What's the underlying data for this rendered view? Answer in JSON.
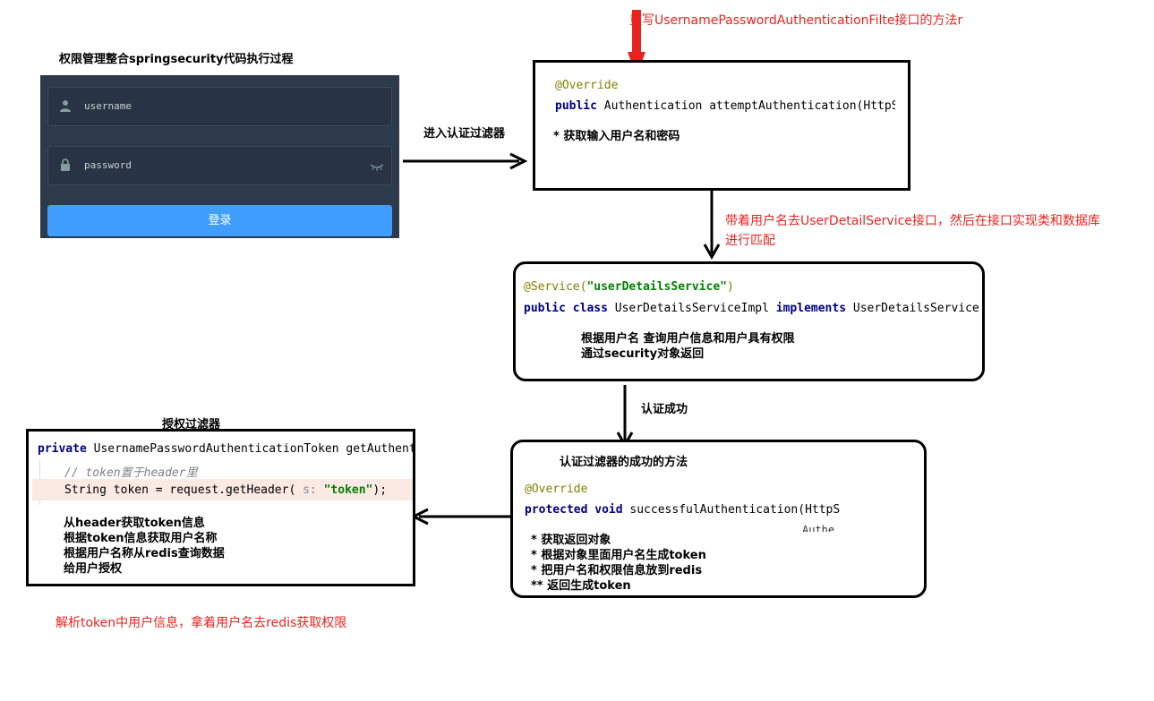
{
  "title": "权限管理整合springsecurity代码执行过程",
  "login": {
    "username_placeholder": "username",
    "password_placeholder": "password",
    "login_button": "登录"
  },
  "arrows": {
    "enter_filter": "进入认证过滤器",
    "auth_success": "认证成功"
  },
  "annotations": {
    "override_note": "重写UsernamePasswordAuthenticationFilte接口的方法r",
    "user_detail_note_line1": "带着用户名去UserDetailService接口，然后在接口实现类和数据库",
    "user_detail_note_line2": "进行匹配",
    "parse_token_note": "解析token中用户信息，拿着用户名去redis获取权限"
  },
  "box_attempt": {
    "annotation": "@Override",
    "kw_public": "public",
    "signature": " Authentication attemptAuthentication(HttpS",
    "note": "* 获取输入用户名和密码"
  },
  "box_service": {
    "annotation": "@Service(",
    "annotation_value": "\"userDetailsService\"",
    "annotation_close": ")",
    "kw_public_class": "public class",
    "class_name": " UserDetailsServiceImpl ",
    "kw_implements": "implements",
    "interface_name": " UserDetailsService",
    "note_line1": "根据用户名 查询用户信息和用户具有权限",
    "note_line2": "通过security对象返回"
  },
  "box_success": {
    "heading": "认证过滤器的成功的方法",
    "annotation": "@Override",
    "kw_protected_void": "protected void",
    "signature": " successfulAuthentication(HttpS",
    "cutoff": "Authe",
    "notes": [
      " * 获取返回对象",
      " * 根据对象里面用户名生成token",
      " * 把用户名和权限信息放到redis",
      " ** 返回生成token"
    ]
  },
  "box_authz": {
    "heading": "授权过滤器",
    "kw_private": "private",
    "signature": " UsernamePasswordAuthenticationToken getAuthenticati",
    "comment": "// token置于header里",
    "code_prefix": "String token = request.getHeader(",
    "param_hint": " s:",
    "code_string": " \"token\"",
    "code_suffix": ");",
    "notes": [
      "从header获取token信息",
      "根据token信息获取用户名称",
      "根据用户名称从redis查询数据",
      "给用户授权"
    ]
  }
}
